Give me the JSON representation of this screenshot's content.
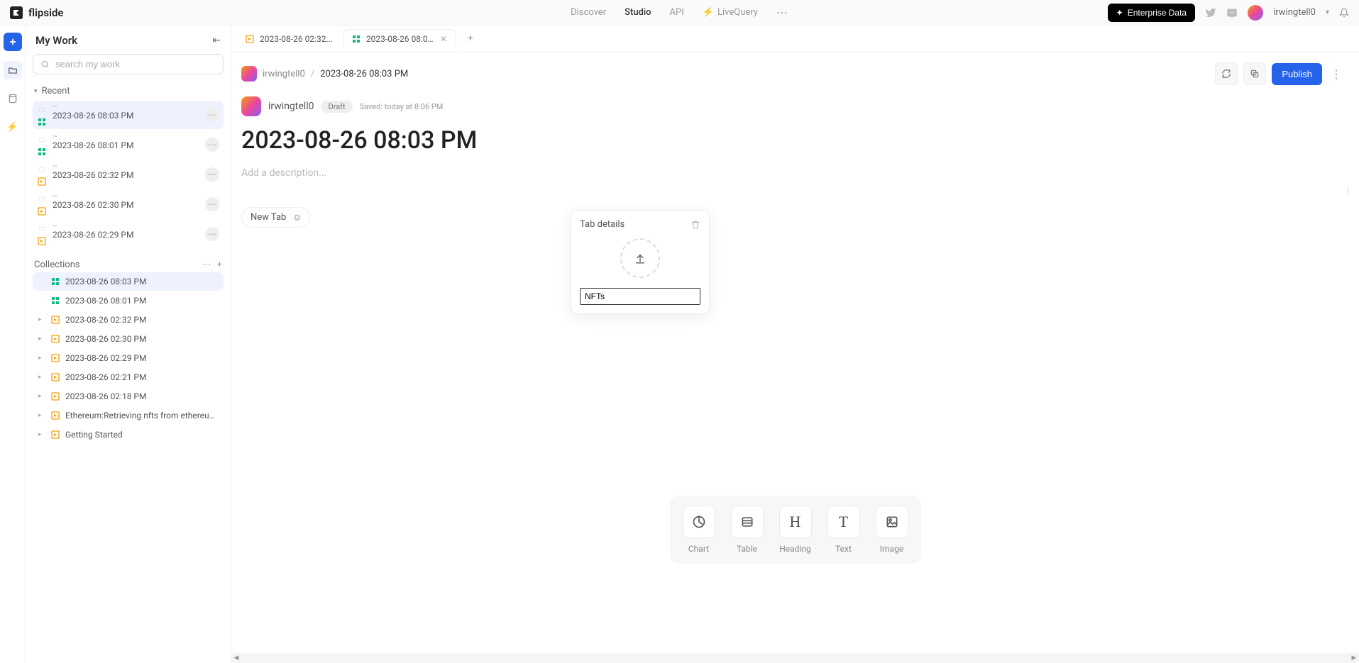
{
  "brand": "flipside",
  "nav": {
    "discover": "Discover",
    "studio": "Studio",
    "api": "API",
    "livequery": "LiveQuery"
  },
  "enterprise_label": "Enterprise Data",
  "user": {
    "name": "irwingtell0"
  },
  "sidebar": {
    "title": "My Work",
    "search_placeholder": "search my work",
    "recent_label": "Recent",
    "recent": [
      {
        "label": "2023-08-26 08:03 PM",
        "type": "green",
        "sel": true
      },
      {
        "label": "2023-08-26 08:01 PM",
        "type": "green",
        "sel": false
      },
      {
        "label": "2023-08-26 02:32 PM",
        "type": "orange",
        "sel": false
      },
      {
        "label": "2023-08-26 02:30 PM",
        "type": "orange",
        "sel": false
      },
      {
        "label": "2023-08-26 02:29 PM",
        "type": "orange",
        "sel": false
      }
    ],
    "collections_label": "Collections",
    "collections": [
      {
        "label": "2023-08-26 08:03 PM",
        "type": "green",
        "chev": false,
        "sel": true
      },
      {
        "label": "2023-08-26 08:01 PM",
        "type": "green",
        "chev": false,
        "sel": false
      },
      {
        "label": "2023-08-26 02:32 PM",
        "type": "orange",
        "chev": true,
        "sel": false
      },
      {
        "label": "2023-08-26 02:30 PM",
        "type": "orange",
        "chev": true,
        "sel": false
      },
      {
        "label": "2023-08-26 02:29 PM",
        "type": "orange",
        "chev": true,
        "sel": false
      },
      {
        "label": "2023-08-26 02:21 PM",
        "type": "orange",
        "chev": true,
        "sel": false
      },
      {
        "label": "2023-08-26 02:18 PM",
        "type": "orange",
        "chev": true,
        "sel": false
      },
      {
        "label": "Ethereum:Retrieving nfts from ethereum...",
        "type": "orange",
        "chev": true,
        "sel": false
      },
      {
        "label": "Getting Started",
        "type": "orange",
        "chev": true,
        "sel": false
      }
    ]
  },
  "tabs": [
    {
      "label": "2023-08-26 02:32...",
      "type": "orange",
      "active": false,
      "closable": false
    },
    {
      "label": "2023-08-26 08:03...",
      "type": "green",
      "active": true,
      "closable": true
    }
  ],
  "breadcrumb": {
    "user": "irwingtell0",
    "title": "2023-08-26 08:03 PM"
  },
  "publish_label": "Publish",
  "doc": {
    "user": "irwingtell0",
    "draft_label": "Draft",
    "saved_label": "Saved: today at 8:06 PM",
    "title": "2023-08-26 08:03 PM",
    "desc_placeholder": "Add a description...",
    "newtab_label": "New Tab"
  },
  "popup": {
    "title": "Tab details",
    "input_value": "NFTs"
  },
  "insert": {
    "chart": "Chart",
    "table": "Table",
    "heading": "Heading",
    "text": "Text",
    "image": "Image"
  }
}
